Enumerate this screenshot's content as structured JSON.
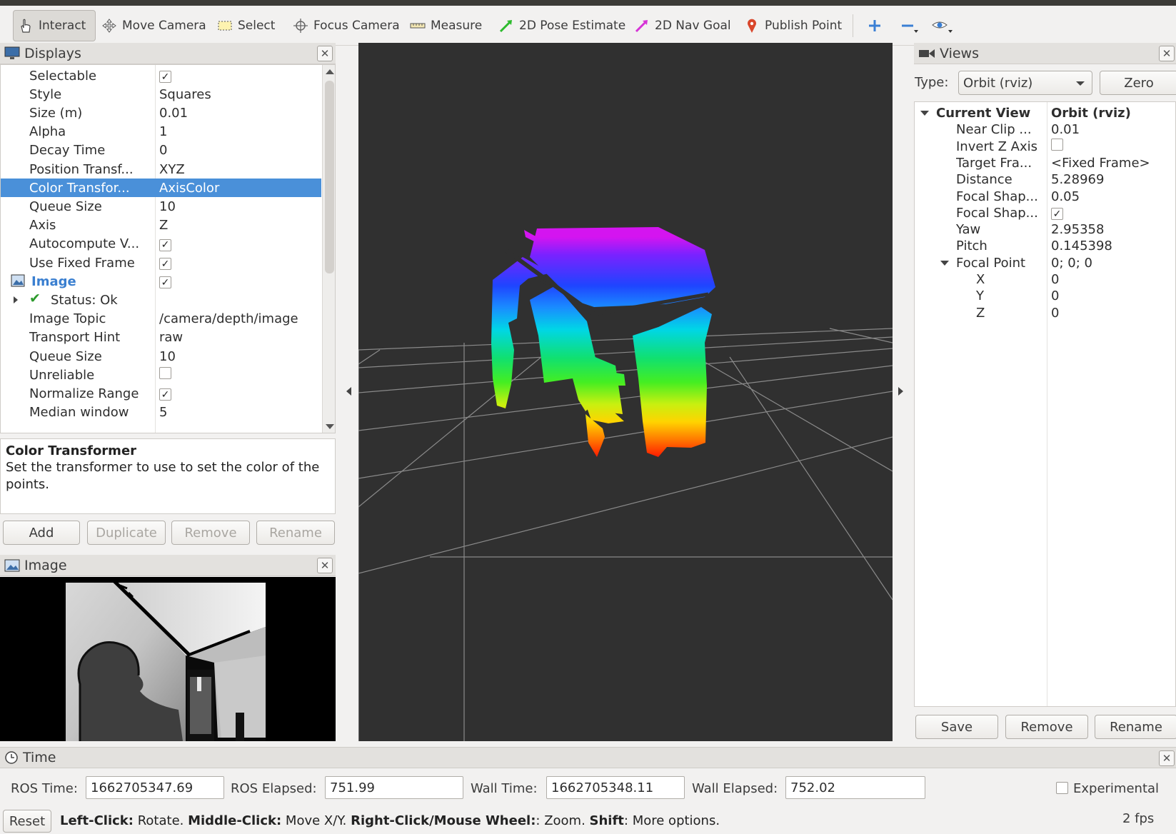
{
  "toolbar": {
    "tools": [
      {
        "label": "Interact",
        "icon": "hand-pointer-icon"
      },
      {
        "label": "Move Camera",
        "icon": "move-camera-icon"
      },
      {
        "label": "Select",
        "icon": "select-rect-icon"
      },
      {
        "label": "Focus Camera",
        "icon": "focus-camera-icon"
      },
      {
        "label": "Measure",
        "icon": "ruler-icon"
      },
      {
        "label": "2D Pose Estimate",
        "icon": "green-arrow-icon"
      },
      {
        "label": "2D Nav Goal",
        "icon": "magenta-arrow-icon"
      },
      {
        "label": "Publish Point",
        "icon": "map-pin-icon"
      }
    ],
    "extra_icons": [
      "plus-icon",
      "minus-icon",
      "eye-icon"
    ]
  },
  "displays": {
    "title": "Displays",
    "rows": [
      {
        "key": "Selectable",
        "value": "",
        "check": true
      },
      {
        "key": "Style",
        "value": "Squares"
      },
      {
        "key": "Size (m)",
        "value": "0.01"
      },
      {
        "key": "Alpha",
        "value": "1"
      },
      {
        "key": "Decay Time",
        "value": "0"
      },
      {
        "key": "Position Transf...",
        "value": "XYZ"
      },
      {
        "key": "Color Transfor...",
        "value": "AxisColor",
        "selected": true
      },
      {
        "key": "Queue Size",
        "value": "10"
      },
      {
        "key": "Axis",
        "value": "Z"
      },
      {
        "key": "Autocompute V...",
        "value": "",
        "check": true
      },
      {
        "key": "Use Fixed Frame",
        "value": "",
        "check": true
      },
      {
        "key": "Image",
        "value": "",
        "check": true,
        "header": true
      },
      {
        "key": "Status: Ok",
        "value": "",
        "status": true
      },
      {
        "key": "Image Topic",
        "value": "/camera/depth/image"
      },
      {
        "key": "Transport Hint",
        "value": "raw"
      },
      {
        "key": "Queue Size",
        "value": "10"
      },
      {
        "key": "Unreliable",
        "value": "",
        "check": false
      },
      {
        "key": "Normalize Range",
        "value": "",
        "check": true
      },
      {
        "key": "Median window",
        "value": "5"
      }
    ],
    "description_title": "Color Transformer",
    "description_text": "Set the transformer to use to set the color of the points.",
    "buttons": {
      "add": "Add",
      "duplicate": "Duplicate",
      "remove": "Remove",
      "rename": "Rename"
    }
  },
  "image_panel": {
    "title": "Image"
  },
  "views": {
    "title": "Views",
    "type_label": "Type:",
    "type_value": "Orbit (rviz)",
    "zero_button": "Zero",
    "rows": [
      {
        "key": "Current View",
        "value": "Orbit (rviz)",
        "bold": true,
        "expand": true,
        "indent": 0
      },
      {
        "key": "Near Clip ...",
        "value": "0.01",
        "indent": 1
      },
      {
        "key": "Invert Z Axis",
        "value": "",
        "check": false,
        "indent": 1
      },
      {
        "key": "Target Fra...",
        "value": "<Fixed Frame>",
        "indent": 1
      },
      {
        "key": "Distance",
        "value": "5.28969",
        "indent": 1
      },
      {
        "key": "Focal Shap...",
        "value": "0.05",
        "indent": 1
      },
      {
        "key": "Focal Shap...",
        "value": "",
        "check": true,
        "indent": 1
      },
      {
        "key": "Yaw",
        "value": "2.95358",
        "indent": 1
      },
      {
        "key": "Pitch",
        "value": "0.145398",
        "indent": 1
      },
      {
        "key": "Focal Point",
        "value": "0; 0; 0",
        "expand": true,
        "indent": 1
      },
      {
        "key": "X",
        "value": "0",
        "indent": 2
      },
      {
        "key": "Y",
        "value": "0",
        "indent": 2
      },
      {
        "key": "Z",
        "value": "0",
        "indent": 2
      }
    ],
    "buttons": {
      "save": "Save",
      "remove": "Remove",
      "rename": "Rename"
    }
  },
  "time": {
    "title": "Time",
    "ros_time_label": "ROS Time:",
    "ros_time": "1662705347.69",
    "ros_elapsed_label": "ROS Elapsed:",
    "ros_elapsed": "751.99",
    "wall_time_label": "Wall Time:",
    "wall_time": "1662705348.11",
    "wall_elapsed_label": "Wall Elapsed:",
    "wall_elapsed": "752.02",
    "experimental_label": "Experimental"
  },
  "status": {
    "reset": "Reset",
    "hint_parts": [
      {
        "text": "Left-Click:",
        "bold": true
      },
      {
        "text": " Rotate. ",
        "bold": false
      },
      {
        "text": "Middle-Click:",
        "bold": true
      },
      {
        "text": " Move X/Y. ",
        "bold": false
      },
      {
        "text": "Right-Click/Mouse Wheel:",
        "bold": true
      },
      {
        "text": ": Zoom. ",
        "bold": false
      },
      {
        "text": "Shift",
        "bold": true
      },
      {
        "text": ": More options.",
        "bold": false
      }
    ],
    "fps": "2 fps"
  }
}
